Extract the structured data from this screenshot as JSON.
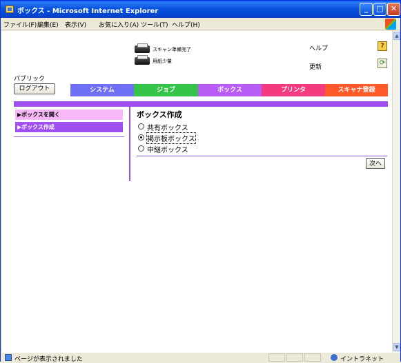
{
  "window": {
    "title": "ボックス - Microsoft Internet Explorer",
    "minimize": "_",
    "maximize": "□",
    "close": "✕"
  },
  "menubar": {
    "items": [
      "ファイル(F)",
      "編集(E)",
      "表示(V)",
      "お気に入り(A)",
      "ツール(T)",
      "ヘルプ(H)"
    ]
  },
  "header": {
    "status_scan": "スキャン準備完了",
    "status_paper": "用紙少量",
    "help_label": "ヘルプ",
    "help_icon": "?",
    "refresh_label": "更新",
    "refresh_icon": "⟳",
    "user_mode": "パブリック",
    "logout_label": "ログアウト"
  },
  "tabs": [
    {
      "label": "システム",
      "color": "#6f6ff5"
    },
    {
      "label": "ジョブ",
      "color": "#35c44a"
    },
    {
      "label": "ボックス",
      "color": "#b85cf5"
    },
    {
      "label": "プリンタ",
      "color": "#f43b80"
    },
    {
      "label": "スキャナ登録",
      "color": "#ff5a28"
    }
  ],
  "sidebar": {
    "items": [
      {
        "label": "▶ボックスを開く"
      },
      {
        "label": "▶ボックス作成"
      }
    ]
  },
  "main": {
    "title": "ボックス作成",
    "options": [
      {
        "label": "共有ボックス",
        "checked": false
      },
      {
        "label": "掲示板ボックス",
        "checked": true
      },
      {
        "label": "中継ボックス",
        "checked": false
      }
    ],
    "next_label": "次へ"
  },
  "statusbar": {
    "text": "ページが表示されました",
    "zone": "イントラネット"
  },
  "scrollbar": {
    "up": "▲",
    "down": "▼"
  }
}
